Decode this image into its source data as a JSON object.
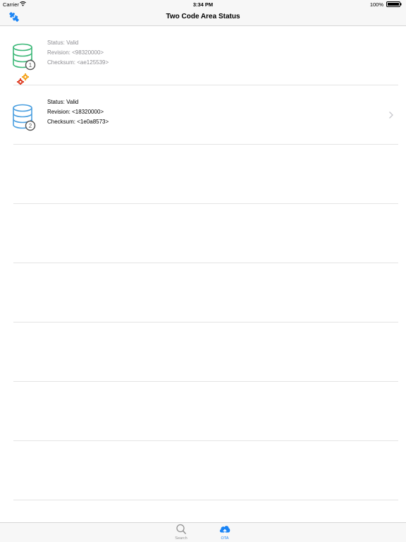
{
  "status_bar": {
    "carrier": "Carrier",
    "time": "3:34 PM",
    "battery": "100%"
  },
  "nav": {
    "title": "Two Code Area Status",
    "left_icon": "plug-connection-icon"
  },
  "code_areas": [
    {
      "badge": "1",
      "status": "Status: Valid",
      "revision": "Revision: <98320000>",
      "checksum": "Checksum: <ae125539>",
      "active": false,
      "icon_color": "#3cb878",
      "secondary_icon": "gears-icon"
    },
    {
      "badge": "2",
      "status": "Status: Valid",
      "revision": "Revision: <18320000>",
      "checksum": "Checksum: <1e0a8573>",
      "active": true,
      "icon_color": "#4a9fe0",
      "disclosure": "chevron-right-icon"
    }
  ],
  "tabs": [
    {
      "label": "Search",
      "icon": "magnifier-icon",
      "selected": false
    },
    {
      "label": "OTA",
      "icon": "cloud-upload-icon",
      "selected": true
    }
  ],
  "colors": {
    "accent": "#1a84f5",
    "inactive_text": "#8e8e93",
    "bar_background": "#f7f7f7",
    "separator": "#e4e4e4",
    "gear_orange": "#f5a623",
    "gear_red": "#e0442b"
  }
}
